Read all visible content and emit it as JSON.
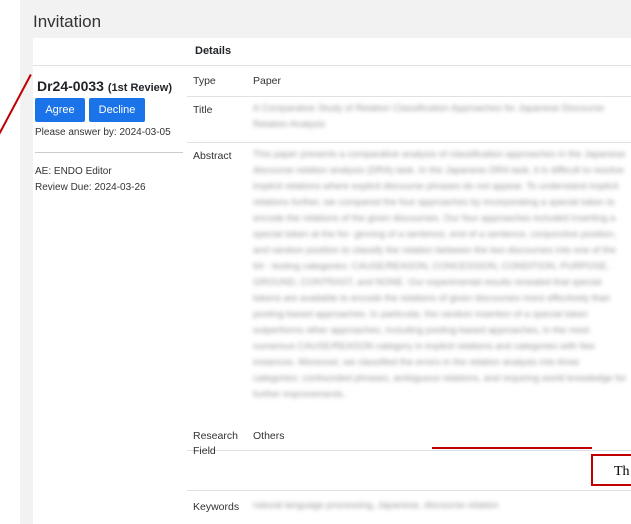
{
  "page": {
    "title": "Invitation"
  },
  "table": {
    "details_header": "Details"
  },
  "manuscript": {
    "id": "Dr24-0033",
    "review_round": "(1st Review)",
    "agree_label": "Agree",
    "decline_label": "Decline",
    "answer_by": "Please answer by: 2024-03-05",
    "ae": "AE: ENDO Editor",
    "review_due": "Review Due: 2024-03-26"
  },
  "details": {
    "type_label": "Type",
    "type_value": "Paper",
    "title_label": "Title",
    "title_value": "A Comparative Study of Relation Classification Approaches for Japanese Discourse Relation Analysis",
    "abstract_label": "Abstract",
    "abstract_value": "This paper presents a comparative analysis of classification approaches in the Japanese discourse relation analysis (DRA) task. In the Japanese DRA task, it is difficult to resolve implicit relations where explicit discourse phrases do not appear. To understand implicit relations further, we compared the four approaches by incorporating a special token to encode the relations of the given discourses. Our four approaches included inserting a special token at the for- ginning of a sentence, end of a sentence, conjunctive position, and random position to classify the relation between the two discourses into one of the 64 - testing categories: CAUSE/REASON, CONCESSION, CONDITION, PURPOSE, GROUND, CONTRAST, and NONE. Our experimental results revealed that special tokens are available to encode the relations of given discourses more effectively than pooling-based approaches. In particular, the random insertion of a special token outperforms other approaches, including pooling-based approaches, in the most numerous CAUSE/REASON category in implicit relations and categories with few instances. Moreover, we classified the errors in the relation analysis into three categories: confounded phrases, ambiguous relations, and requiring world knowledge for further improvements.",
    "research_field_label": "Research Field",
    "research_field_value": "Others",
    "keywords_label": "Keywords",
    "keywords_value": "natural language processing, Japanese, discourse relation"
  },
  "annotation": {
    "callout_text": "Th",
    "color": "#c00000"
  },
  "colors": {
    "primary_button": "#1a73e8",
    "page_background": "#f2f2f2"
  }
}
